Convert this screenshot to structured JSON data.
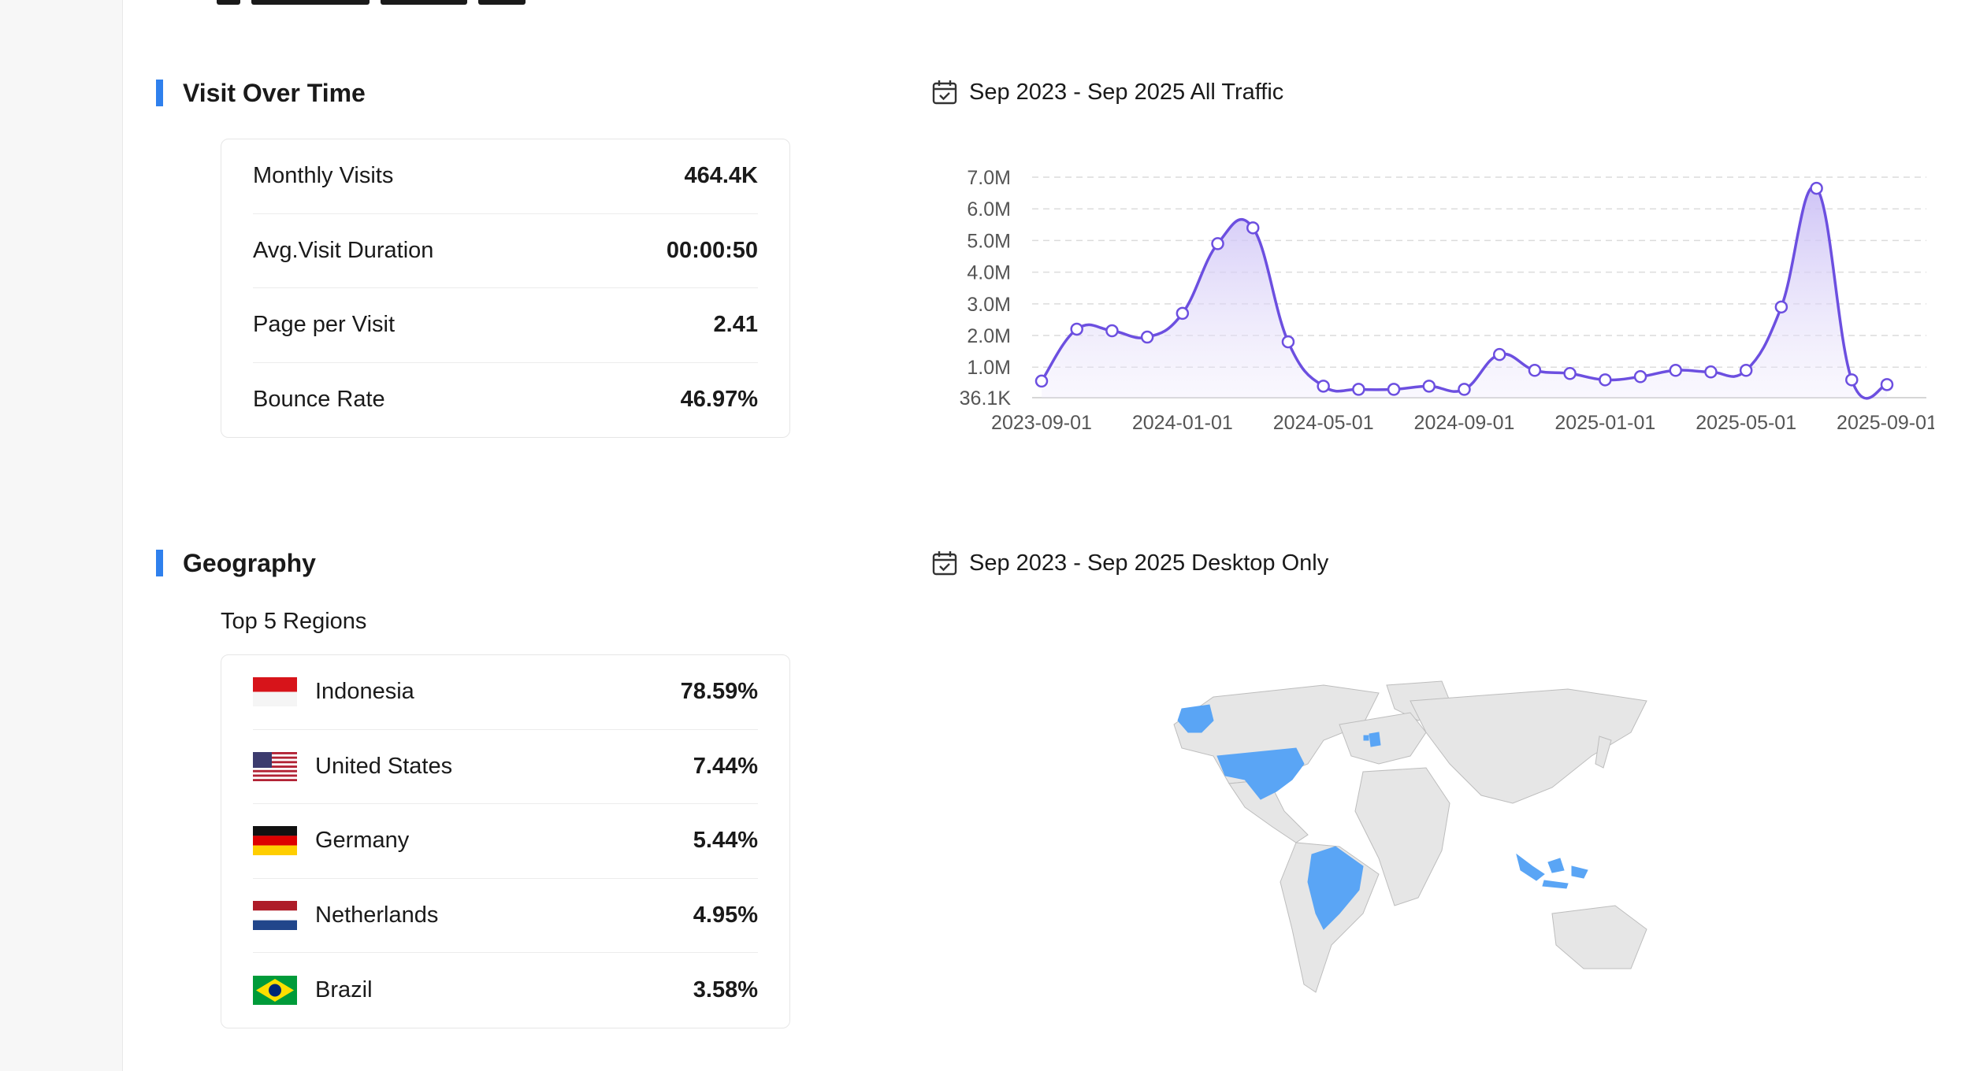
{
  "visit_section": {
    "title": "Visit Over Time",
    "date_range": "Sep 2023 - Sep 2025 All Traffic",
    "metrics": [
      {
        "label": "Monthly Visits",
        "value": "464.4K"
      },
      {
        "label": "Avg.Visit Duration",
        "value": "00:00:50"
      },
      {
        "label": "Page per Visit",
        "value": "2.41"
      },
      {
        "label": "Bounce Rate",
        "value": "46.97%"
      }
    ]
  },
  "chart_data": {
    "type": "area",
    "x": [
      "2023-09-01",
      "2023-10-01",
      "2023-11-01",
      "2023-12-01",
      "2024-01-01",
      "2024-02-01",
      "2024-03-01",
      "2024-04-01",
      "2024-05-01",
      "2024-06-01",
      "2024-07-01",
      "2024-08-01",
      "2024-09-01",
      "2024-10-01",
      "2024-11-01",
      "2024-12-01",
      "2025-01-01",
      "2025-02-01",
      "2025-03-01",
      "2025-04-01",
      "2025-05-01",
      "2025-06-01",
      "2025-07-01",
      "2025-08-01",
      "2025-09-01"
    ],
    "x_tick_labels": [
      "2023-09-01",
      "2024-01-01",
      "2024-05-01",
      "2024-09-01",
      "2025-01-01",
      "2025-05-01",
      "2025-09-01"
    ],
    "series": [
      {
        "values": [
          560000,
          2200000,
          2150000,
          1950000,
          2700000,
          4900000,
          5400000,
          1800000,
          400000,
          300000,
          300000,
          400000,
          300000,
          1400000,
          900000,
          800000,
          600000,
          700000,
          900000,
          850000,
          900000,
          2900000,
          6650000,
          600000,
          450000
        ]
      }
    ],
    "y_tick_labels": [
      "36.1K",
      "1.0M",
      "2.0M",
      "3.0M",
      "4.0M",
      "5.0M",
      "6.0M",
      "7.0M"
    ],
    "y_ticks": [
      36100,
      1000000,
      2000000,
      3000000,
      4000000,
      5000000,
      6000000,
      7000000
    ],
    "ylim": [
      36100,
      7000000
    ],
    "grid": true,
    "line_color": "#6c4fe0",
    "fill_color": "#ece7fb"
  },
  "geo_section": {
    "title": "Geography",
    "date_range": "Sep 2023 - Sep 2025 Desktop Only",
    "subtitle": "Top 5 Regions",
    "regions": [
      {
        "name": "Indonesia",
        "value": "78.59%",
        "flag": "indonesia-flag"
      },
      {
        "name": "United States",
        "value": "7.44%",
        "flag": "us-flag"
      },
      {
        "name": "Germany",
        "value": "5.44%",
        "flag": "germany-flag"
      },
      {
        "name": "Netherlands",
        "value": "4.95%",
        "flag": "netherlands-flag"
      },
      {
        "name": "Brazil",
        "value": "3.58%",
        "flag": "brazil-flag"
      }
    ],
    "map_highlight_color": "#5aa5f5",
    "map_base_color": "#e6e6e6"
  }
}
